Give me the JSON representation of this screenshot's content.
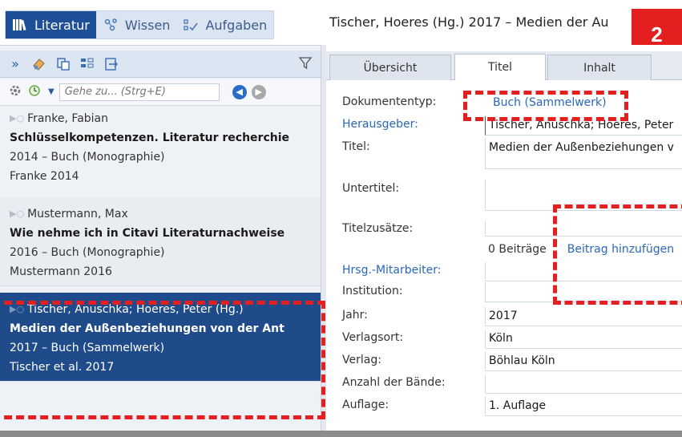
{
  "nav": {
    "tabs": [
      {
        "label": "Literatur"
      },
      {
        "label": "Wissen"
      },
      {
        "label": "Aufgaben"
      }
    ]
  },
  "document_title": "Tischer, Hoeres (Hg.) 2017 – Medien der Au",
  "badge": "2",
  "search": {
    "placeholder": "Gehe zu... (Strg+E)"
  },
  "references": [
    {
      "author": "Franke, Fabian",
      "title": "Schlüsselkompetenzen. Literatur recherchie",
      "line3": "2014 – Buch (Monographie)",
      "line4": "Franke 2014"
    },
    {
      "author": "Mustermann, Max",
      "title": "Wie nehme ich in Citavi Literaturnachweise",
      "line3": "2016 – Buch (Monographie)",
      "line4": "Mustermann 2016"
    },
    {
      "author": "Tischer, Anuschka; Hoeres, Peter (Hg.)",
      "title": "Medien der Außenbeziehungen von der Ant",
      "line3": "2017 – Buch (Sammelwerk)",
      "line4": "Tischer et al. 2017"
    }
  ],
  "tabs": [
    {
      "label": "Übersicht"
    },
    {
      "label": "Titel"
    },
    {
      "label": "Inhalt"
    }
  ],
  "fields": {
    "doc_type_label": "Dokumententyp:",
    "doc_type_value": "Buch (Sammelwerk)",
    "editor_label": "Herausgeber:",
    "editor_value": "Tischer, Anuschka; Hoeres, Peter",
    "title_label": "Titel:",
    "title_value": "Medien der Außenbeziehungen v",
    "subtitle_label": "Untertitel:",
    "title_add_label": "Titelzusätze:",
    "contrib_count": "0 Beiträge",
    "contrib_add": "Beitrag hinzufügen",
    "co_editor_label": "Hrsg.-Mitarbeiter:",
    "institution_label": "Institution:",
    "year_label": "Jahr:",
    "year_value": "2017",
    "place_label": "Verlagsort:",
    "place_value": "Köln",
    "publisher_label": "Verlag:",
    "publisher_value": "Böhlau Köln",
    "volumes_label": "Anzahl der Bände:",
    "edition_label": "Auflage:",
    "edition_value": "1. Auflage"
  },
  "colors": {
    "accent": "#1e4f96",
    "selection": "#1f4b8b",
    "annotation": "#e31f1f",
    "link": "#2b67b8"
  }
}
